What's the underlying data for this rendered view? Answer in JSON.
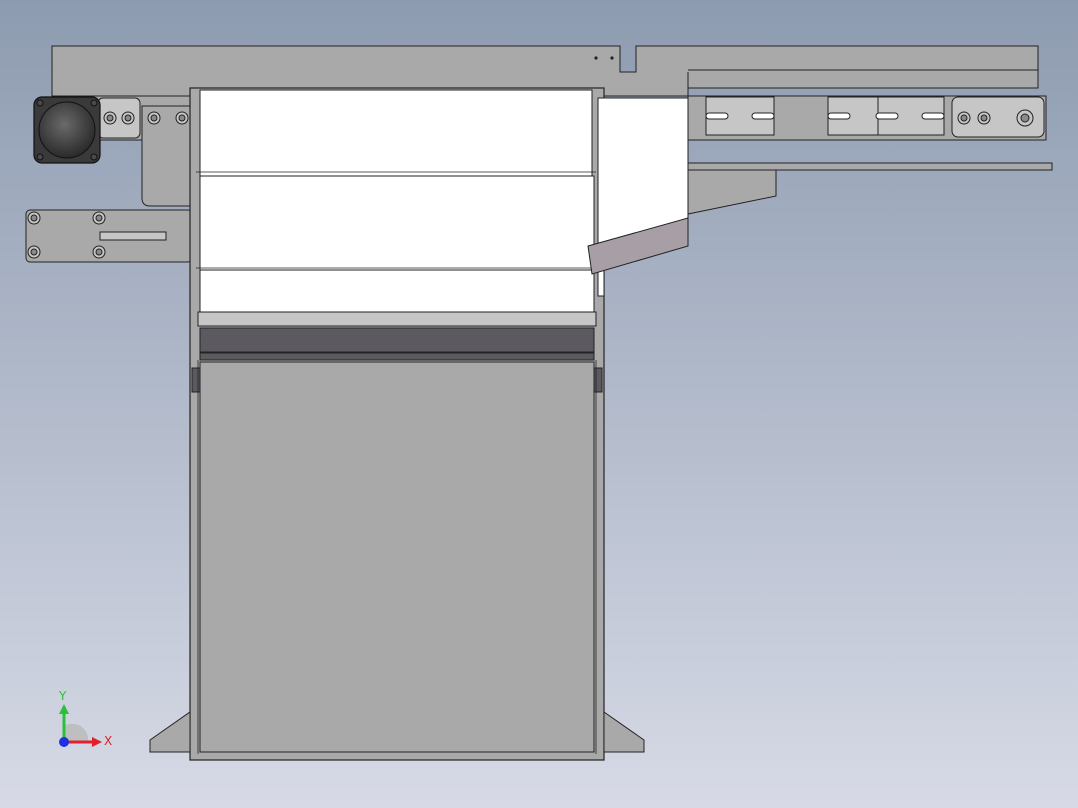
{
  "viewport": {
    "background_top": "#8d9bb0",
    "background_bottom": "#d7dae6"
  },
  "colors": {
    "sheet_metal": "#a9a9a9",
    "sheet_metal_light": "#c6c6c6",
    "edge": "#222222",
    "white_panel": "#ffffff",
    "dark_band": "#5c5960",
    "mauve_deflector": "#a79ea6",
    "motor": "#3a3a3a",
    "axis_x": "#e0202a",
    "axis_y": "#2bbf3a",
    "axis_z": "#2030e0"
  },
  "triad": {
    "x_label": "X",
    "y_label": "Y"
  }
}
